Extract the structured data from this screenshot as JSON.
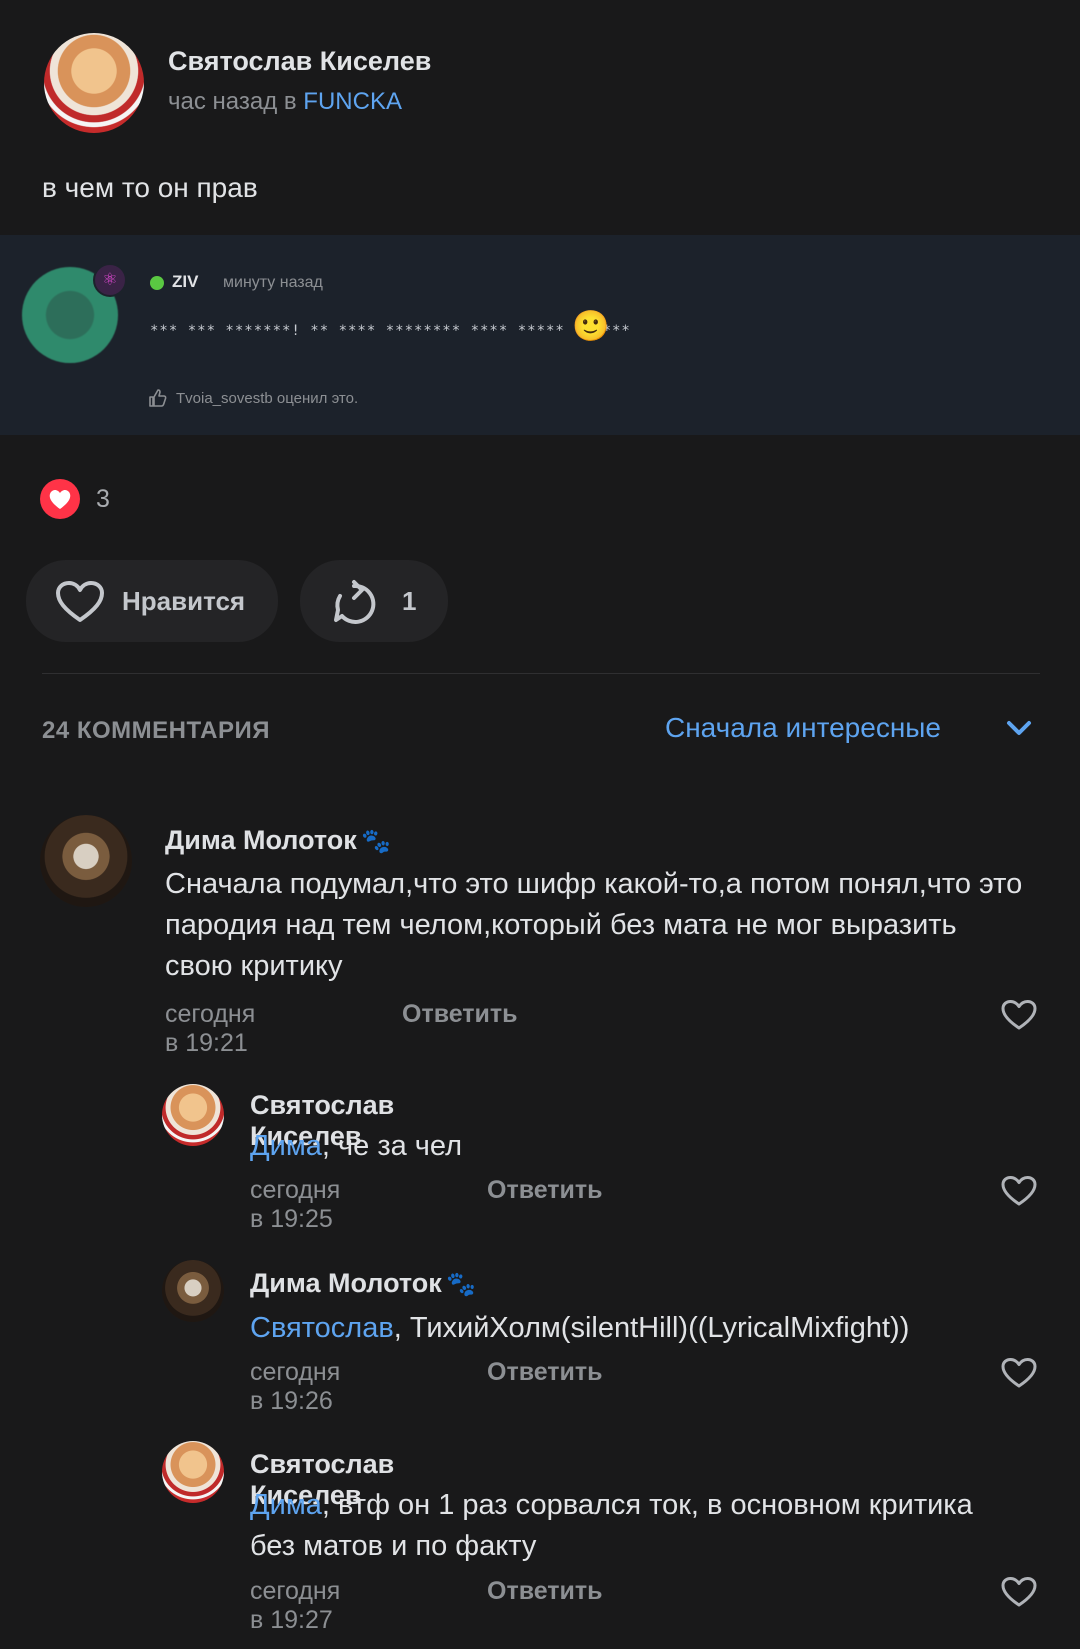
{
  "post": {
    "author": "Святослав Киселев",
    "time_prefix": "час назад в",
    "group": "FUNCKA",
    "text": "в чем то он прав"
  },
  "embed": {
    "name": "ZIV",
    "time": "минуту назад",
    "censored_text": "*** *** *******! ** **** ******** **** ***** ******",
    "emoji": "🙂",
    "liked_by": "Tvoia_sovestb оценил это."
  },
  "reactions": {
    "heart_count": "3"
  },
  "actions": {
    "like_label": "Нравится",
    "share_count": "1"
  },
  "comments_header": {
    "count_label": "24 КОММЕНТАРИЯ",
    "sort_label": "Сначала интересные"
  },
  "comments": [
    {
      "author": "Дима Молоток",
      "paw": "🐾",
      "mention": "",
      "text": "Сначала подумал,что это шифр какой-то,а потом понял,что это пародия над тем челом,который без мата не мог выразить свою критику",
      "time": "сегодня в 19:21",
      "reply": "Ответить"
    },
    {
      "author": "Святослав Киселев",
      "mention": "Дима",
      "text": ", че за чел",
      "time": "сегодня в 19:25",
      "reply": "Ответить"
    },
    {
      "author": "Дима Молоток",
      "paw": "🐾",
      "mention": "Святослав",
      "text": ", ТихийХолм(silentHill)((LyricalMixfight))",
      "time": "сегодня в 19:26",
      "reply": "Ответить"
    },
    {
      "author": "Святослав Киселев",
      "mention": "Дима",
      "text": ", втф он 1 раз сорвался ток, в основном критика без матов и по факту",
      "time": "сегодня в 19:27",
      "reply": "Ответить"
    }
  ],
  "icons": {
    "heart_filled": "heart-filled-icon",
    "heart_outline": "heart-outline-icon",
    "share": "share-icon",
    "chevron": "chevron-down-icon",
    "thumb": "thumbs-up-icon"
  },
  "colors": {
    "accent": "#5ea4f0",
    "like_red": "#ff3347",
    "bg": "#19191a"
  }
}
